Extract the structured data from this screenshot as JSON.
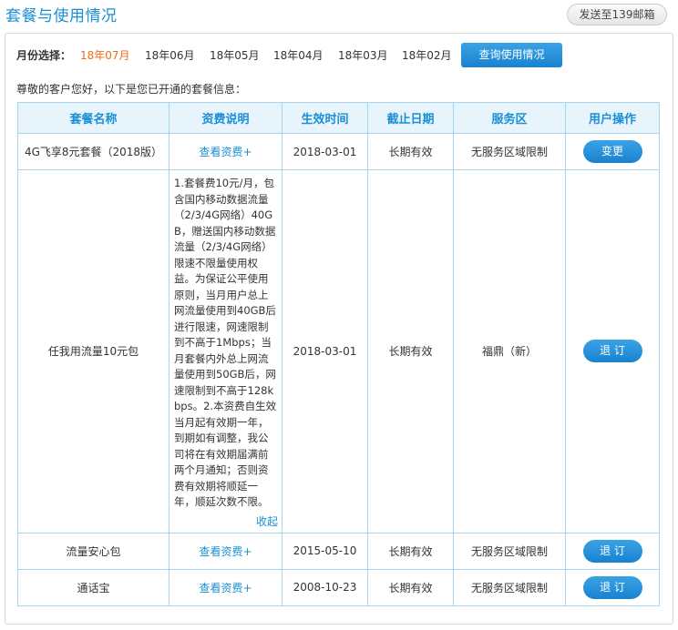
{
  "header": {
    "title": "套餐与使用情况",
    "send_button": "发送至139邮箱"
  },
  "filter": {
    "label": "月份选择：",
    "months": [
      "18年07月",
      "18年06月",
      "18年05月",
      "18年04月",
      "18年03月",
      "18年02月"
    ],
    "selected": "18年07月",
    "query_button": "查询使用情况"
  },
  "greeting": "尊敬的客户您好，以下是您已开通的套餐信息：",
  "table": {
    "headers": [
      "套餐名称",
      "资费说明",
      "生效时间",
      "截止日期",
      "服务区",
      "用户操作"
    ],
    "rows": [
      {
        "name": "4G飞享8元套餐（2018版）",
        "fee": "查看资费+",
        "start": "2018-03-01",
        "end": "长期有效",
        "area": "无服务区域限制",
        "action": "变更"
      },
      {
        "name": "任我用流量10元包",
        "fee_detail": "1.套餐费10元/月，包含国内移动数据流量（2/3/4G网络）40GB，赠送国内移动数据流量（2/3/4G网络）限速不限量使用权益。为保证公平使用原则，当月用户总上网流量使用到40GB后进行限速，网速限制到不高于1Mbps；当月套餐内外总上网流量使用到50GB后，网速限制到不高于128kbps。2.本资费自生效当月起有效期一年，到期如有调整，我公司将在有效期届满前两个月通知；否则资费有效期将顺延一年，顺延次数不限。",
        "fee_collapse": "收起",
        "start": "2018-03-01",
        "end": "长期有效",
        "area": "福鼎（新）",
        "action": "退 订"
      },
      {
        "name": "流量安心包",
        "fee": "查看资费+",
        "start": "2015-05-10",
        "end": "长期有效",
        "area": "无服务区域限制",
        "action": "退 订"
      },
      {
        "name": "通话宝",
        "fee": "查看资费+",
        "start": "2008-10-23",
        "end": "长期有效",
        "area": "无服务区域限制",
        "action": "退 订"
      }
    ]
  }
}
